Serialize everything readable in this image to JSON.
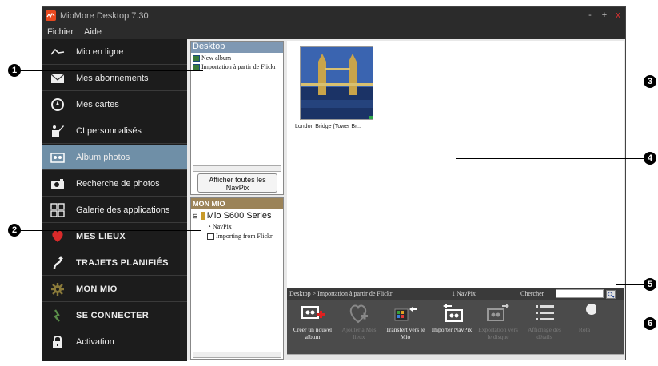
{
  "window": {
    "title": "MioMore Desktop 7.30",
    "controls": {
      "minimize": "-",
      "maximize": "+",
      "close": "x"
    }
  },
  "menu": {
    "items": [
      "Fichier",
      "Aide"
    ]
  },
  "sidebar": {
    "items": [
      {
        "label": "Mio en ligne",
        "icon": "waveform-icon"
      },
      {
        "label": "Mes abonnements",
        "icon": "envelope-icon"
      },
      {
        "label": "Mes cartes",
        "icon": "compass-icon"
      },
      {
        "label": "CI personnalisés",
        "icon": "pencil-poi-icon"
      },
      {
        "label": "Album photos",
        "icon": "photo-album-icon",
        "active": true
      },
      {
        "label": "Recherche de photos",
        "icon": "camera-icon"
      },
      {
        "label": "Galerie des applications",
        "icon": "apps-grid-icon"
      },
      {
        "label": "MES LIEUX",
        "icon": "heart-icon",
        "bold": true
      },
      {
        "label": "TRAJETS PLANIFIÉS",
        "icon": "route-icon",
        "bold": true
      },
      {
        "label": "MON MIO",
        "icon": "gear-icon",
        "bold": true
      },
      {
        "label": "SE CONNECTER",
        "icon": "connect-icon",
        "bold": true
      },
      {
        "label": "Activation",
        "icon": "lock-icon"
      }
    ]
  },
  "desktop_panel": {
    "title": "Desktop",
    "items": [
      "New album",
      "Importation à partir de Flickr"
    ],
    "show_all_button": "Afficher toutes les NavPix"
  },
  "mio_panel": {
    "title": "MON MIO",
    "device": "Mio S600 Series",
    "items": [
      "NavPix",
      "Importing from Flickr"
    ]
  },
  "content": {
    "photo": {
      "caption": "London Bridge (Tower Br..."
    }
  },
  "statusbar": {
    "breadcrumb": "Desktop > Importation à partir de Flickr",
    "count": "1 NavPix",
    "search_label": "Chercher",
    "search_value": ""
  },
  "toolbar": {
    "items": [
      {
        "label": "Créer un nouvel album",
        "icon": "new-album-icon",
        "enabled": true
      },
      {
        "label": "Ajouter à Mes lieux",
        "icon": "add-to-places-icon",
        "enabled": false
      },
      {
        "label": "Transfert vers le Mio",
        "icon": "transfer-to-mio-icon",
        "enabled": true
      },
      {
        "label": "Importer NavPix",
        "icon": "import-navpix-icon",
        "enabled": true
      },
      {
        "label": "Exportation vers le disque",
        "icon": "export-to-disk-icon",
        "enabled": false
      },
      {
        "label": "Affichage des détails",
        "icon": "details-list-icon",
        "enabled": false
      },
      {
        "label": "Rota",
        "icon": "rotate-icon",
        "enabled": false
      }
    ]
  },
  "callouts": [
    "1",
    "2",
    "3",
    "4",
    "5",
    "6"
  ],
  "colors": {
    "accent_active": "#6f8fa7",
    "desktop_header": "#7f98b3",
    "mio_header": "#9b8358",
    "sidebar_bg": "#1c1c1c",
    "logo": "#e8491f"
  }
}
